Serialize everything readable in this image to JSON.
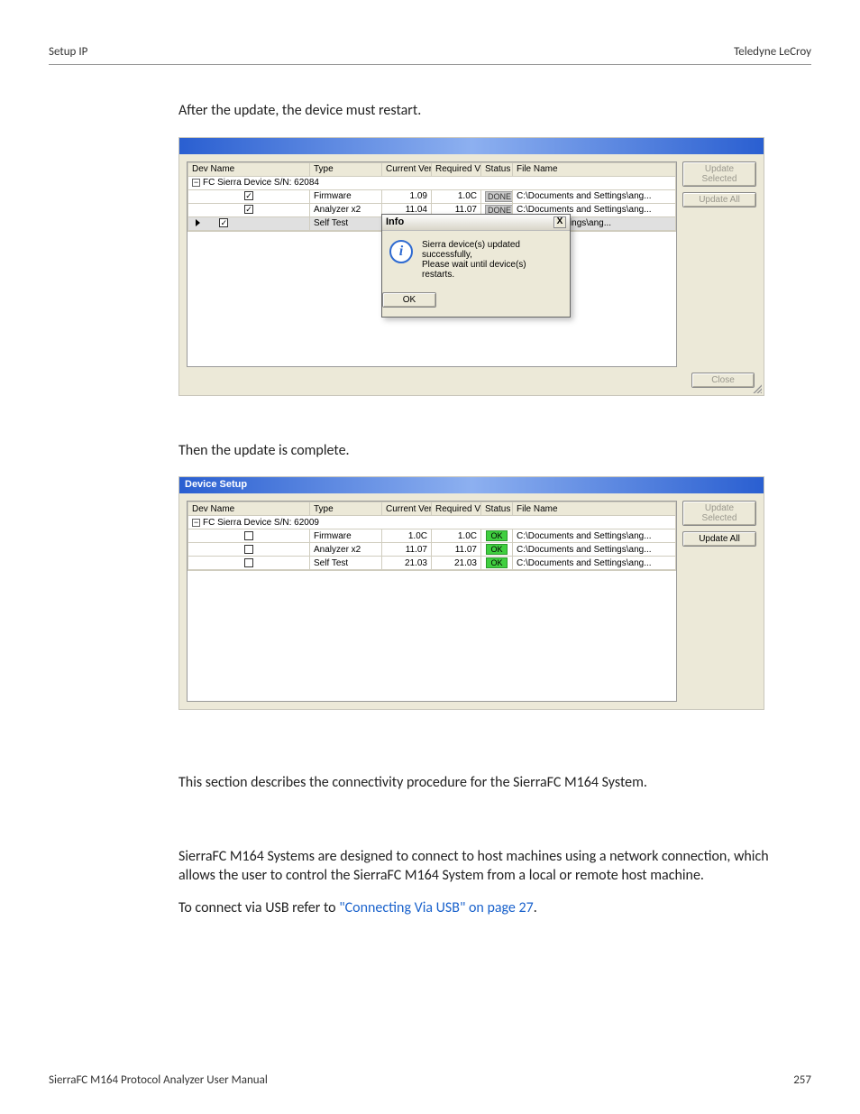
{
  "header": {
    "left": "Setup IP",
    "right": "Teledyne LeCroy"
  },
  "para1": "After the update, the device must restart.",
  "para2": "Then the update is complete.",
  "para3": "This section describes the connectivity procedure for the SierraFC M164 System.",
  "para4_pre": "SierraFC M164 Systems are designed to connect to host machines using a network connection, which allows the user to control the SierraFC M164 System from a local or remote host machine.",
  "para5_pre": "To connect via USB refer to ",
  "para5_link": "\"Connecting Via USB\" on page 27",
  "para5_post": ".",
  "footer": {
    "left": "SierraFC M164 Protocol Analyzer User Manual",
    "right": "257"
  },
  "shot1": {
    "cols": {
      "dev": "Dev Name",
      "type": "Type",
      "cur": "Current Ver",
      "req": "Required Ver",
      "stat": "Status",
      "file": "File Name"
    },
    "group": "FC Sierra Device S/N: 62084",
    "rows": [
      {
        "checked": true,
        "type": "Firmware",
        "cur": "1.09",
        "req": "1.0C",
        "status": "DONE",
        "file": "C:\\Documents and Settings\\ang..."
      },
      {
        "checked": true,
        "type": "Analyzer x2",
        "cur": "11.04",
        "req": "11.07",
        "status": "DONE",
        "file": "C:\\Documents and Settings\\ang..."
      },
      {
        "checked": true,
        "type": "Self Test",
        "cur": "",
        "req": "",
        "status": "",
        "file": "ents and Settings\\ang...",
        "selected": true
      }
    ],
    "buttons": {
      "updSel": "Update Selected",
      "updAll": "Update All",
      "close": "Close"
    },
    "dialog": {
      "title": "Info",
      "text1": "Sierra device(s) updated successfully,",
      "text2": "Please wait until device(s) restarts.",
      "ok": "OK"
    }
  },
  "shot2": {
    "title": "Device Setup",
    "cols": {
      "dev": "Dev Name",
      "type": "Type",
      "cur": "Current Ver",
      "req": "Required Ver",
      "stat": "Status",
      "file": "File Name"
    },
    "group": "FC Sierra Device S/N: 62009",
    "rows": [
      {
        "checked": false,
        "type": "Firmware",
        "cur": "1.0C",
        "req": "1.0C",
        "status": "OK",
        "file": "C:\\Documents and Settings\\ang..."
      },
      {
        "checked": false,
        "type": "Analyzer x2",
        "cur": "11.07",
        "req": "11.07",
        "status": "OK",
        "file": "C:\\Documents and Settings\\ang..."
      },
      {
        "checked": false,
        "type": "Self Test",
        "cur": "21.03",
        "req": "21.03",
        "status": "OK",
        "file": "C:\\Documents and Settings\\ang..."
      }
    ],
    "buttons": {
      "updSel": "Update Selected",
      "updAll": "Update All"
    }
  }
}
